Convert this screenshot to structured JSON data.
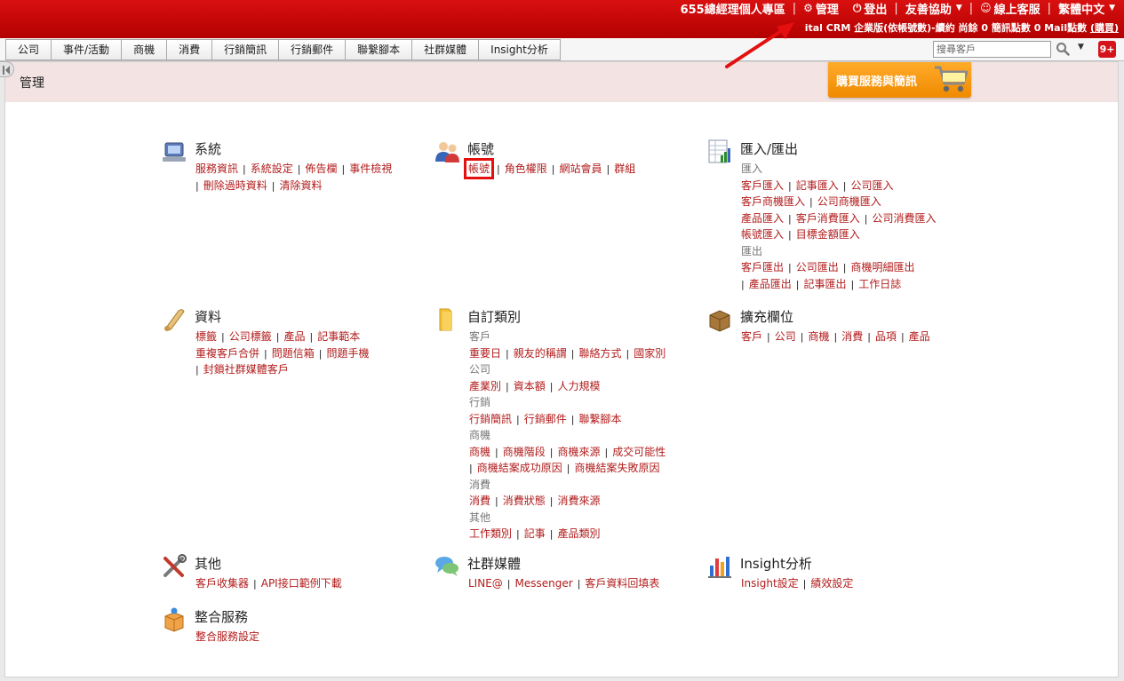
{
  "topbar": {
    "user_area": "655總經理個人專區",
    "manage": "管理",
    "logout": "登出",
    "help": "友善協助",
    "online_support": "線上客服",
    "language": "繁體中文",
    "plan_info": "ital CRM 企業版(依帳號數)-續約  尚餘 0 簡訊點數 0 Mail點數",
    "buy_link": "(購買)"
  },
  "nav": {
    "tabs": [
      "公司",
      "事件/活動",
      "商機",
      "消費",
      "行銷簡訊",
      "行銷郵件",
      "聯繫腳本",
      "社群媒體",
      "Insight分析"
    ],
    "search_placeholder": "搜尋客戶",
    "badge": "9+"
  },
  "header": {
    "title": "管理",
    "buy_button": "購買服務與簡訊"
  },
  "sections": {
    "system": {
      "title": "系統",
      "line1": [
        "服務資訊",
        "系統設定",
        "佈告欄",
        "事件檢視"
      ],
      "line2": [
        "刪除過時資料",
        "清除資料"
      ]
    },
    "account": {
      "title": "帳號",
      "links": [
        "帳號",
        "角色權限",
        "網站會員",
        "群組"
      ]
    },
    "import_export": {
      "title": "匯入/匯出",
      "import_label": "匯入",
      "import_line1": [
        "客戶匯入",
        "記事匯入",
        "公司匯入"
      ],
      "import_line2": [
        "客戶商機匯入",
        "公司商機匯入"
      ],
      "import_line3": [
        "產品匯入",
        "客戶消費匯入",
        "公司消費匯入"
      ],
      "import_line4": [
        "帳號匯入",
        "目標金額匯入"
      ],
      "export_label": "匯出",
      "export_line1": [
        "客戶匯出",
        "公司匯出",
        "商機明細匯出"
      ],
      "export_line2": [
        "產品匯出",
        "記事匯出",
        "工作日誌"
      ]
    },
    "data": {
      "title": "資料",
      "line1": [
        "標籤",
        "公司標籤",
        "產品",
        "記事範本"
      ],
      "line2": [
        "重複客戶合併",
        "問題信箱",
        "問題手機"
      ],
      "line3": [
        "封鎖社群媒體客戶"
      ]
    },
    "custom_categories": {
      "title": "自訂類別",
      "customer_label": "客戶",
      "customer_links": [
        "重要日",
        "親友的稱謂",
        "聯絡方式",
        "國家別"
      ],
      "company_label": "公司",
      "company_links": [
        "產業別",
        "資本額",
        "人力規模"
      ],
      "marketing_label": "行銷",
      "marketing_links": [
        "行銷簡訊",
        "行銷郵件",
        "聯繫腳本"
      ],
      "opportunity_label": "商機",
      "opportunity_line1": [
        "商機",
        "商機階段",
        "商機來源",
        "成交可能性"
      ],
      "opportunity_line2": [
        "商機結案成功原因",
        "商機結案失敗原因"
      ],
      "consumption_label": "消費",
      "consumption_links": [
        "消費",
        "消費狀態",
        "消費來源"
      ],
      "other_label": "其他",
      "other_links": [
        "工作類別",
        "記事",
        "產品類別"
      ]
    },
    "extended_fields": {
      "title": "擴充欄位",
      "links": [
        "客戶",
        "公司",
        "商機",
        "消費",
        "品項",
        "產品"
      ]
    },
    "other": {
      "title": "其他",
      "links": [
        "客戶收集器",
        "API接口範例下載"
      ]
    },
    "social": {
      "title": "社群媒體",
      "links": [
        "LINE@",
        "Messenger",
        "客戶資料回填表"
      ]
    },
    "insight": {
      "title": "Insight分析",
      "links": [
        "Insight設定",
        "績效設定"
      ]
    },
    "integration": {
      "title": "整合服務",
      "links": [
        "整合服務設定"
      ]
    }
  },
  "colors": {
    "topbar_red": "#c70808",
    "link_red": "#b21c1c",
    "header_pink": "#f3e3e3",
    "buy_orange": "#f59a10",
    "highlight_red": "#e41010"
  }
}
